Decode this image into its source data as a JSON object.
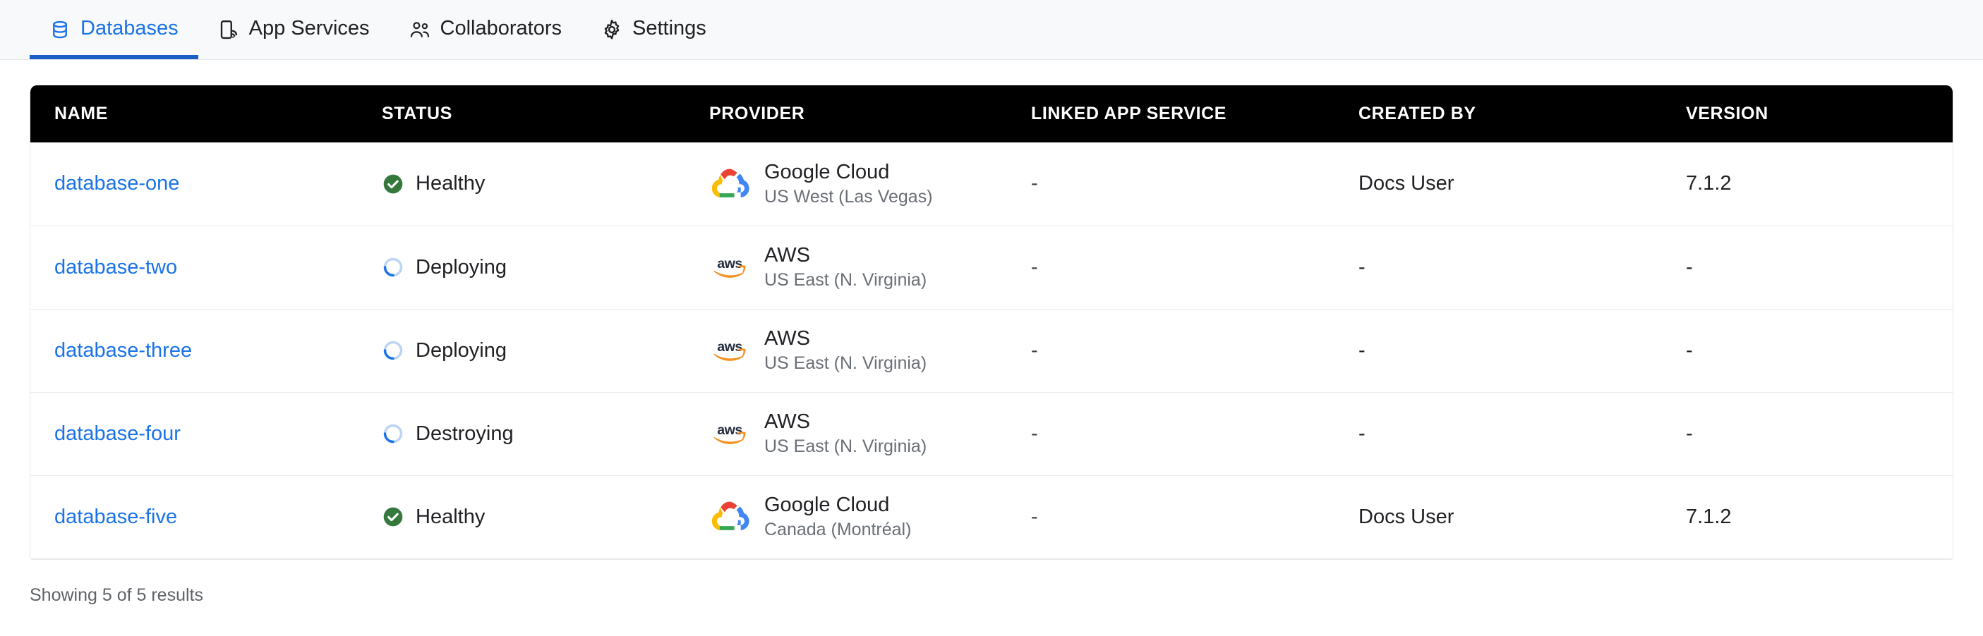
{
  "tabs": [
    {
      "label": "Databases",
      "icon": "database-icon",
      "active": true
    },
    {
      "label": "App Services",
      "icon": "app-services-icon",
      "active": false
    },
    {
      "label": "Collaborators",
      "icon": "collaborators-icon",
      "active": false
    },
    {
      "label": "Settings",
      "icon": "gear-icon",
      "active": false
    }
  ],
  "table": {
    "columns": [
      {
        "key": "name",
        "label": "NAME"
      },
      {
        "key": "status",
        "label": "STATUS"
      },
      {
        "key": "provider",
        "label": "PROVIDER"
      },
      {
        "key": "linked",
        "label": "LINKED APP SERVICE"
      },
      {
        "key": "created",
        "label": "CREATED BY"
      },
      {
        "key": "version",
        "label": "VERSION"
      }
    ],
    "rows": [
      {
        "name": "database-one",
        "status": "Healthy",
        "status_icon": "check-circle-icon",
        "provider_logo": "google-cloud-logo",
        "provider_name": "Google Cloud",
        "provider_region": "US West (Las Vegas)",
        "linked": "-",
        "created": "Docs User",
        "version": "7.1.2"
      },
      {
        "name": "database-two",
        "status": "Deploying",
        "status_icon": "spinner-icon",
        "provider_logo": "aws-logo",
        "provider_name": "AWS",
        "provider_region": "US East (N. Virginia)",
        "linked": "-",
        "created": "-",
        "version": "-"
      },
      {
        "name": "database-three",
        "status": "Deploying",
        "status_icon": "spinner-icon",
        "provider_logo": "aws-logo",
        "provider_name": "AWS",
        "provider_region": "US East (N. Virginia)",
        "linked": "-",
        "created": "-",
        "version": "-"
      },
      {
        "name": "database-four",
        "status": "Destroying",
        "status_icon": "spinner-icon",
        "provider_logo": "aws-logo",
        "provider_name": "AWS",
        "provider_region": "US East (N. Virginia)",
        "linked": "-",
        "created": "-",
        "version": "-"
      },
      {
        "name": "database-five",
        "status": "Healthy",
        "status_icon": "check-circle-icon",
        "provider_logo": "google-cloud-logo",
        "provider_name": "Google Cloud",
        "provider_region": "Canada (Montréal)",
        "linked": "-",
        "created": "Docs User",
        "version": "7.1.2"
      }
    ]
  },
  "footer": {
    "results_text": "Showing 5 of 5 results"
  },
  "colors": {
    "accent": "#1a73e8",
    "active_underline": "#1a5fc8",
    "header_bg": "#000000",
    "healthy_green": "#34783c",
    "spinner_blue": "#1a73e8",
    "aws_orange": "#f59022",
    "tabbar_bg": "#f8f9fa"
  }
}
